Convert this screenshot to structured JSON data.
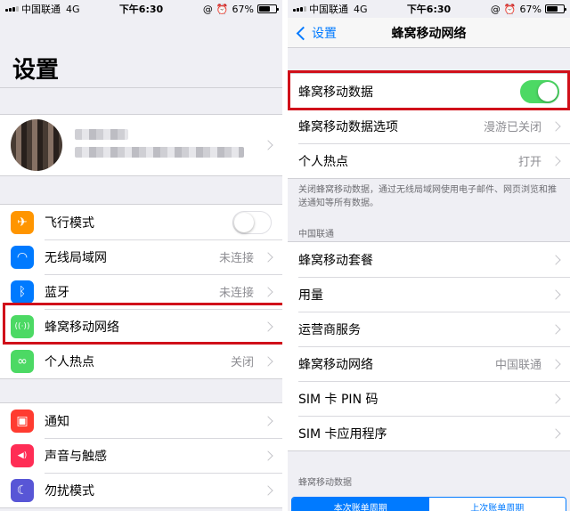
{
  "status": {
    "carrier": "中国联通",
    "network": "4G",
    "time": "下午6:30",
    "battery": "67%",
    "battery_level": 0.67
  },
  "left": {
    "title": "设置",
    "group1": [
      {
        "label": "飞行模式",
        "icon": "airplane-icon",
        "color": "#ff9500",
        "toggle": false
      },
      {
        "label": "无线局域网",
        "icon": "wifi-icon",
        "color": "#007aff",
        "value": "未连接"
      },
      {
        "label": "蓝牙",
        "icon": "bluetooth-icon",
        "color": "#007aff",
        "value": "未连接"
      },
      {
        "label": "蜂窝移动网络",
        "icon": "cellular-icon",
        "color": "#4cd964",
        "value": ""
      },
      {
        "label": "个人热点",
        "icon": "hotspot-icon",
        "color": "#4cd964",
        "value": "关闭"
      }
    ],
    "group2": [
      {
        "label": "通知",
        "icon": "notification-icon",
        "color": "#ff3b30"
      },
      {
        "label": "声音与触感",
        "icon": "sound-icon",
        "color": "#ff2d55"
      },
      {
        "label": "勿扰模式",
        "icon": "moon-icon",
        "color": "#5856d6"
      }
    ]
  },
  "right": {
    "back_label": "设置",
    "title": "蜂窝移动网络",
    "group1": [
      {
        "label": "蜂窝移动数据",
        "toggle": true
      },
      {
        "label": "蜂窝移动数据选项",
        "value": "漫游已关闭"
      },
      {
        "label": "个人热点",
        "value": "打开"
      }
    ],
    "note": "关闭蜂窝移动数据，通过无线局域网使用电子邮件、网页浏览和推送通知等所有数据。",
    "section_carrier": "中国联通",
    "group2": [
      {
        "label": "蜂窝移动套餐",
        "value": ""
      },
      {
        "label": "用量",
        "value": ""
      },
      {
        "label": "运营商服务",
        "value": ""
      },
      {
        "label": "蜂窝移动网络",
        "value": "中国联通"
      },
      {
        "label": "SIM 卡 PIN 码",
        "value": ""
      },
      {
        "label": "SIM 卡应用程序",
        "value": ""
      }
    ],
    "section_data": "蜂窝移动数据",
    "tabs": [
      "本次账单周期",
      "上次账单周期"
    ]
  },
  "highlight_color": "#d0101a"
}
